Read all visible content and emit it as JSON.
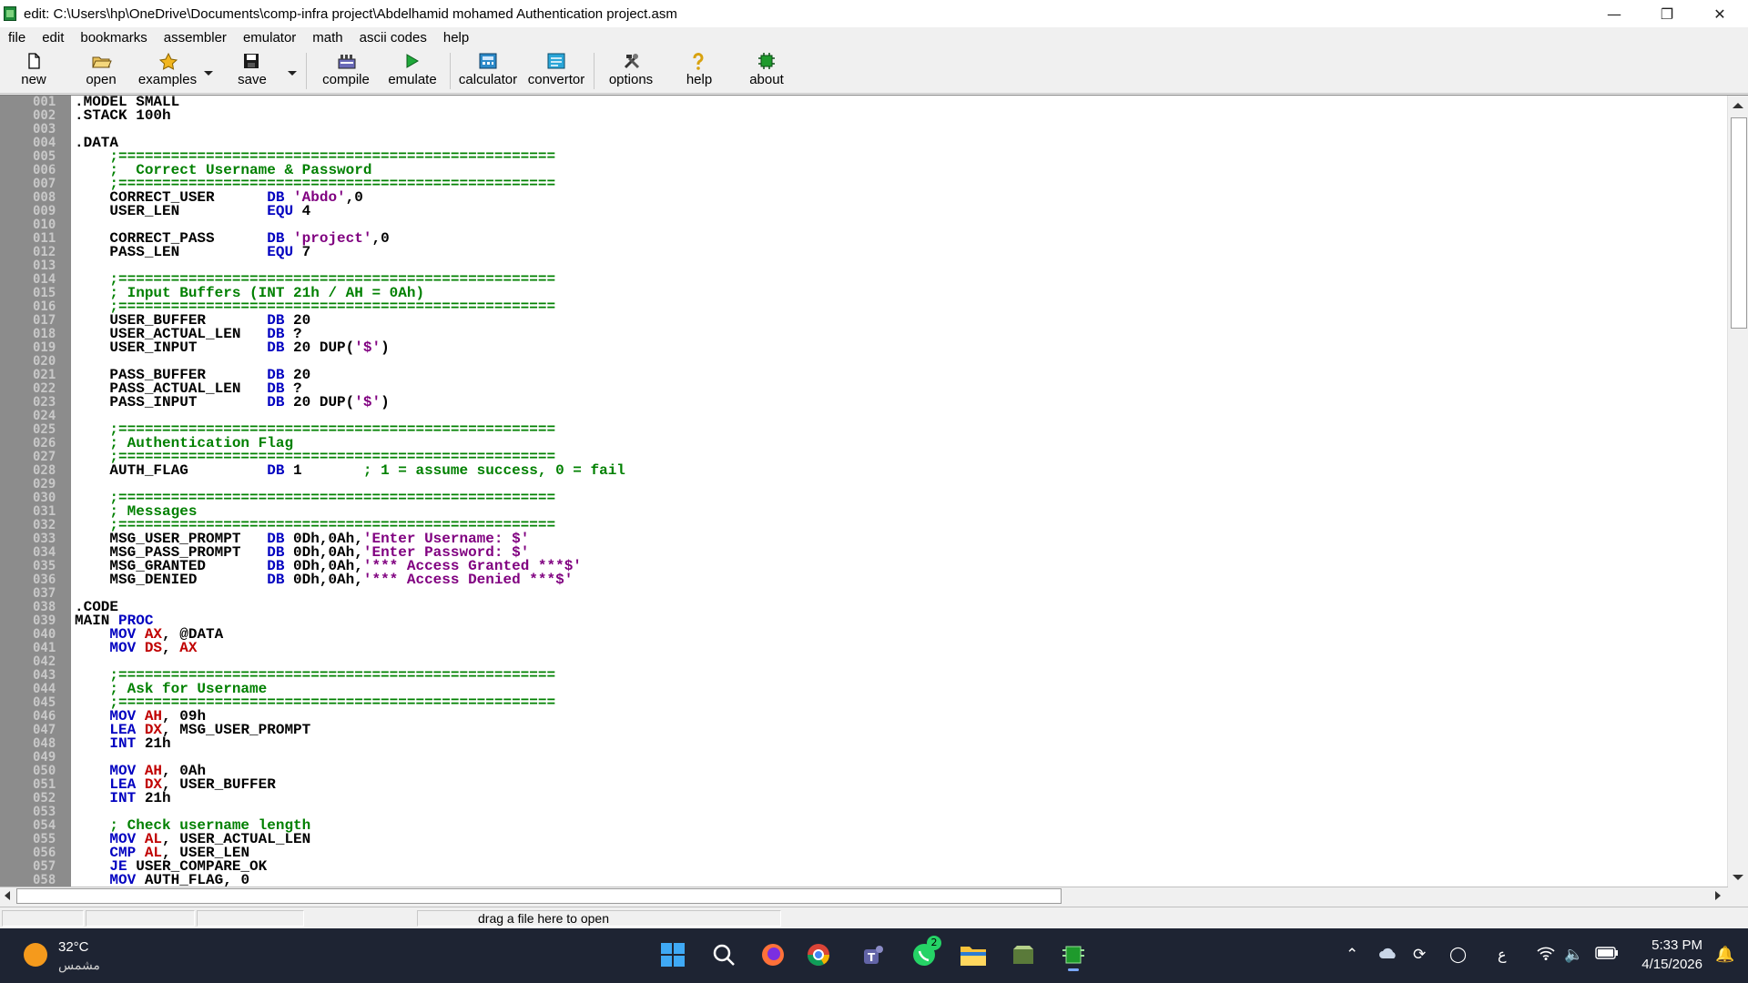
{
  "window": {
    "title": "edit: C:\\Users\\hp\\OneDrive\\Documents\\comp-infra project\\Abdelhamid mohamed Authentication project.asm",
    "minimize_icon": "minimize-icon",
    "restore_icon": "restore-icon",
    "close_icon": "close-icon"
  },
  "menu": [
    "file",
    "edit",
    "bookmarks",
    "assembler",
    "emulator",
    "math",
    "ascii codes",
    "help"
  ],
  "toolbar": {
    "new": "new",
    "open": "open",
    "examples": "examples",
    "save": "save",
    "compile": "compile",
    "emulate": "emulate",
    "calculator": "calculator",
    "convertor": "convertor",
    "options": "options",
    "help": "help",
    "about": "about"
  },
  "editor": {
    "line_numbers": [
      "001",
      "002",
      "003",
      "004",
      "005",
      "006",
      "007",
      "008",
      "009",
      "010",
      "011",
      "012",
      "013",
      "014",
      "015",
      "016",
      "017",
      "018",
      "019",
      "020",
      "021",
      "022",
      "023",
      "024",
      "025",
      "026",
      "027",
      "028",
      "029",
      "030",
      "031",
      "032",
      "033",
      "034",
      "035",
      "036",
      "037",
      "038",
      "039",
      "040",
      "041",
      "042",
      "043",
      "044",
      "045",
      "046",
      "047",
      "048",
      "049",
      "050",
      "051",
      "052",
      "053",
      "054",
      "055",
      "056",
      "057",
      "058"
    ],
    "lines": [
      [
        {
          "t": ".MODEL SMALL"
        }
      ],
      [
        {
          "t": ".STACK 100h"
        }
      ],
      [
        {
          "t": ""
        }
      ],
      [
        {
          "t": ".DATA"
        }
      ],
      [
        {
          "t": "    ;==================================================",
          "c": "cm"
        }
      ],
      [
        {
          "t": "    ;  Correct Username & Password",
          "c": "cm"
        }
      ],
      [
        {
          "t": "    ;==================================================",
          "c": "cm"
        }
      ],
      [
        {
          "t": "    CORRECT_USER      "
        },
        {
          "t": "DB",
          "c": "kw"
        },
        {
          "t": " "
        },
        {
          "t": "'Abdo'",
          "c": "st"
        },
        {
          "t": ",0"
        }
      ],
      [
        {
          "t": "    USER_LEN          "
        },
        {
          "t": "EQU",
          "c": "kw"
        },
        {
          "t": " 4"
        }
      ],
      [
        {
          "t": ""
        }
      ],
      [
        {
          "t": "    CORRECT_PASS      "
        },
        {
          "t": "DB",
          "c": "kw"
        },
        {
          "t": " "
        },
        {
          "t": "'project'",
          "c": "st"
        },
        {
          "t": ",0"
        }
      ],
      [
        {
          "t": "    PASS_LEN          "
        },
        {
          "t": "EQU",
          "c": "kw"
        },
        {
          "t": " 7"
        }
      ],
      [
        {
          "t": ""
        }
      ],
      [
        {
          "t": "    ;==================================================",
          "c": "cm"
        }
      ],
      [
        {
          "t": "    ; Input Buffers (INT 21h / AH = 0Ah)",
          "c": "cm"
        }
      ],
      [
        {
          "t": "    ;==================================================",
          "c": "cm"
        }
      ],
      [
        {
          "t": "    USER_BUFFER       "
        },
        {
          "t": "DB",
          "c": "kw"
        },
        {
          "t": " 20"
        }
      ],
      [
        {
          "t": "    USER_ACTUAL_LEN   "
        },
        {
          "t": "DB",
          "c": "kw"
        },
        {
          "t": " ?"
        }
      ],
      [
        {
          "t": "    USER_INPUT        "
        },
        {
          "t": "DB",
          "c": "kw"
        },
        {
          "t": " 20 DUP("
        },
        {
          "t": "'$'",
          "c": "st"
        },
        {
          "t": ")"
        }
      ],
      [
        {
          "t": ""
        }
      ],
      [
        {
          "t": "    PASS_BUFFER       "
        },
        {
          "t": "DB",
          "c": "kw"
        },
        {
          "t": " 20"
        }
      ],
      [
        {
          "t": "    PASS_ACTUAL_LEN   "
        },
        {
          "t": "DB",
          "c": "kw"
        },
        {
          "t": " ?"
        }
      ],
      [
        {
          "t": "    PASS_INPUT        "
        },
        {
          "t": "DB",
          "c": "kw"
        },
        {
          "t": " 20 DUP("
        },
        {
          "t": "'$'",
          "c": "st"
        },
        {
          "t": ")"
        }
      ],
      [
        {
          "t": ""
        }
      ],
      [
        {
          "t": "    ;==================================================",
          "c": "cm"
        }
      ],
      [
        {
          "t": "    ; Authentication Flag",
          "c": "cm"
        }
      ],
      [
        {
          "t": "    ;==================================================",
          "c": "cm"
        }
      ],
      [
        {
          "t": "    AUTH_FLAG         "
        },
        {
          "t": "DB",
          "c": "kw"
        },
        {
          "t": " 1       "
        },
        {
          "t": "; 1 = assume success, 0 = fail",
          "c": "cm"
        }
      ],
      [
        {
          "t": ""
        }
      ],
      [
        {
          "t": "    ;==================================================",
          "c": "cm"
        }
      ],
      [
        {
          "t": "    ; Messages",
          "c": "cm"
        }
      ],
      [
        {
          "t": "    ;==================================================",
          "c": "cm"
        }
      ],
      [
        {
          "t": "    MSG_USER_PROMPT   "
        },
        {
          "t": "DB",
          "c": "kw"
        },
        {
          "t": " 0Dh,0Ah,"
        },
        {
          "t": "'Enter Username: $'",
          "c": "st"
        }
      ],
      [
        {
          "t": "    MSG_PASS_PROMPT   "
        },
        {
          "t": "DB",
          "c": "kw"
        },
        {
          "t": " 0Dh,0Ah,"
        },
        {
          "t": "'Enter Password: $'",
          "c": "st"
        }
      ],
      [
        {
          "t": "    MSG_GRANTED       "
        },
        {
          "t": "DB",
          "c": "kw"
        },
        {
          "t": " 0Dh,0Ah,"
        },
        {
          "t": "'*** Access Granted ***$'",
          "c": "st"
        }
      ],
      [
        {
          "t": "    MSG_DENIED        "
        },
        {
          "t": "DB",
          "c": "kw"
        },
        {
          "t": " 0Dh,0Ah,"
        },
        {
          "t": "'*** Access Denied ***$'",
          "c": "st"
        }
      ],
      [
        {
          "t": ""
        }
      ],
      [
        {
          "t": ".CODE"
        }
      ],
      [
        {
          "t": "MAIN "
        },
        {
          "t": "PROC",
          "c": "kw"
        }
      ],
      [
        {
          "t": "    "
        },
        {
          "t": "MOV",
          "c": "kw"
        },
        {
          "t": " "
        },
        {
          "t": "AX",
          "c": "rg"
        },
        {
          "t": ", @DATA"
        }
      ],
      [
        {
          "t": "    "
        },
        {
          "t": "MOV",
          "c": "kw"
        },
        {
          "t": " "
        },
        {
          "t": "DS",
          "c": "rg"
        },
        {
          "t": ", "
        },
        {
          "t": "AX",
          "c": "rg"
        }
      ],
      [
        {
          "t": ""
        }
      ],
      [
        {
          "t": "    ;==================================================",
          "c": "cm"
        }
      ],
      [
        {
          "t": "    ; Ask for Username",
          "c": "cm"
        }
      ],
      [
        {
          "t": "    ;==================================================",
          "c": "cm"
        }
      ],
      [
        {
          "t": "    "
        },
        {
          "t": "MOV",
          "c": "kw"
        },
        {
          "t": " "
        },
        {
          "t": "AH",
          "c": "rg"
        },
        {
          "t": ", 09h"
        }
      ],
      [
        {
          "t": "    "
        },
        {
          "t": "LEA",
          "c": "kw"
        },
        {
          "t": " "
        },
        {
          "t": "DX",
          "c": "rg"
        },
        {
          "t": ", MSG_USER_PROMPT"
        }
      ],
      [
        {
          "t": "    "
        },
        {
          "t": "INT",
          "c": "kw"
        },
        {
          "t": " 21h"
        }
      ],
      [
        {
          "t": ""
        }
      ],
      [
        {
          "t": "    "
        },
        {
          "t": "MOV",
          "c": "kw"
        },
        {
          "t": " "
        },
        {
          "t": "AH",
          "c": "rg"
        },
        {
          "t": ", 0Ah"
        }
      ],
      [
        {
          "t": "    "
        },
        {
          "t": "LEA",
          "c": "kw"
        },
        {
          "t": " "
        },
        {
          "t": "DX",
          "c": "rg"
        },
        {
          "t": ", USER_BUFFER"
        }
      ],
      [
        {
          "t": "    "
        },
        {
          "t": "INT",
          "c": "kw"
        },
        {
          "t": " 21h"
        }
      ],
      [
        {
          "t": ""
        }
      ],
      [
        {
          "t": "    ; Check username length",
          "c": "cm"
        }
      ],
      [
        {
          "t": "    "
        },
        {
          "t": "MOV",
          "c": "kw"
        },
        {
          "t": " "
        },
        {
          "t": "AL",
          "c": "rg"
        },
        {
          "t": ", USER_ACTUAL_LEN"
        }
      ],
      [
        {
          "t": "    "
        },
        {
          "t": "CMP",
          "c": "kw"
        },
        {
          "t": " "
        },
        {
          "t": "AL",
          "c": "rg"
        },
        {
          "t": ", USER_LEN"
        }
      ],
      [
        {
          "t": "    "
        },
        {
          "t": "JE",
          "c": "kw"
        },
        {
          "t": " USER_COMPARE_OK"
        }
      ],
      [
        {
          "t": "    "
        },
        {
          "t": "MOV",
          "c": "kw"
        },
        {
          "t": " AUTH_FLAG, 0"
        }
      ]
    ]
  },
  "status": {
    "hint": "drag a file here to open"
  },
  "taskbar": {
    "temperature": "32°C",
    "weather_desc": "مشمس",
    "time": "5:33 PM",
    "date": "4/15/2026",
    "lang": "ع",
    "whatsapp_badge": "2"
  }
}
